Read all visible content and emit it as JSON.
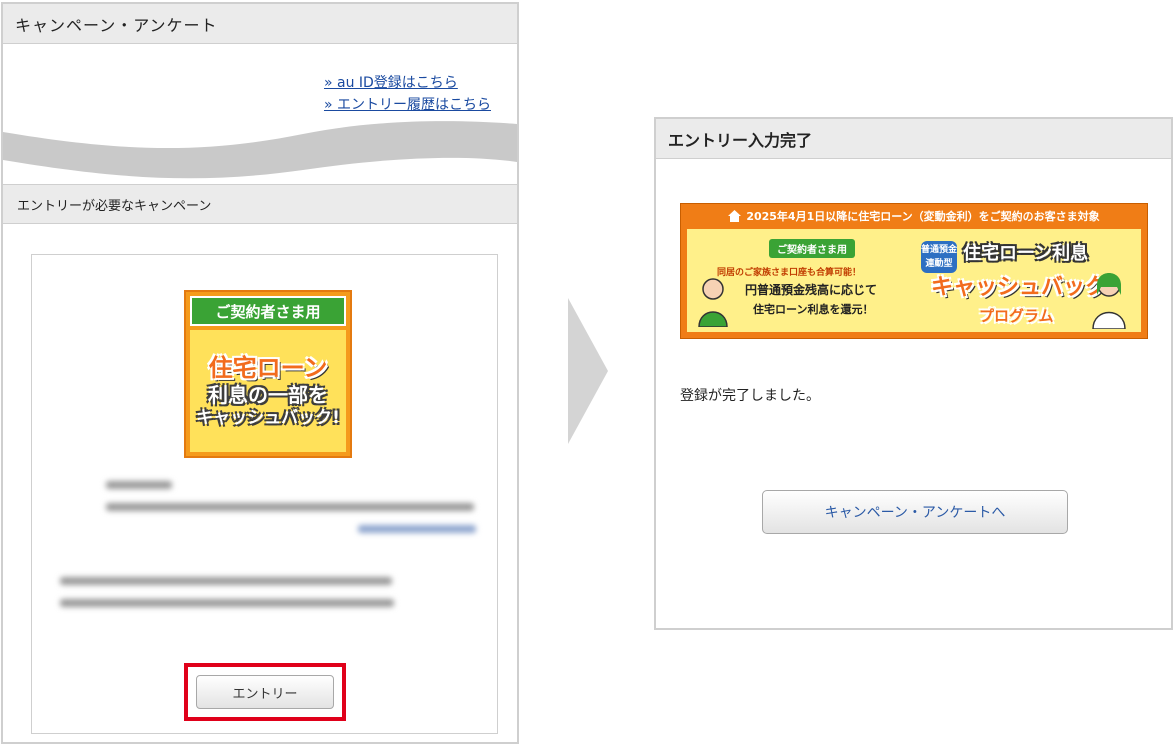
{
  "left_panel": {
    "header_title": "キャンペーン・アンケート",
    "links": [
      "» au ID登録はこちら",
      "» エントリー履歴はこちら"
    ],
    "section_title": "エントリーが必要なキャンペーン",
    "promo": {
      "badge": "ご契約者さま用",
      "line1": "住宅ローン",
      "line2": "利息の一部を",
      "line3": "キャッシュバック!"
    },
    "entry_button_label": "エントリー"
  },
  "right_panel": {
    "header_title": "エントリー入力完了",
    "banner": {
      "top_line": "2025年4月1日以降に住宅ローン（変動金利）をご契約のお客さま対象",
      "tag": "ご契約者さま用",
      "sub": "同居のご家族さま口座も合算可能！",
      "main1": "円普通預金残高に応じて",
      "main2": "住宅ローン利息を還元！",
      "kind": "普通預金連動型",
      "title1": "住宅ローン利息",
      "title2": "キャッシュバック",
      "title3": "プログラム"
    },
    "done_message": "登録が完了しました。",
    "campaign_button_label": "キャンペーン・アンケートへ"
  },
  "colors": {
    "highlight": "#e0001a",
    "link": "#1a4aa0",
    "header_bg": "#ebebeb",
    "banner_orange": "#f07d16"
  }
}
